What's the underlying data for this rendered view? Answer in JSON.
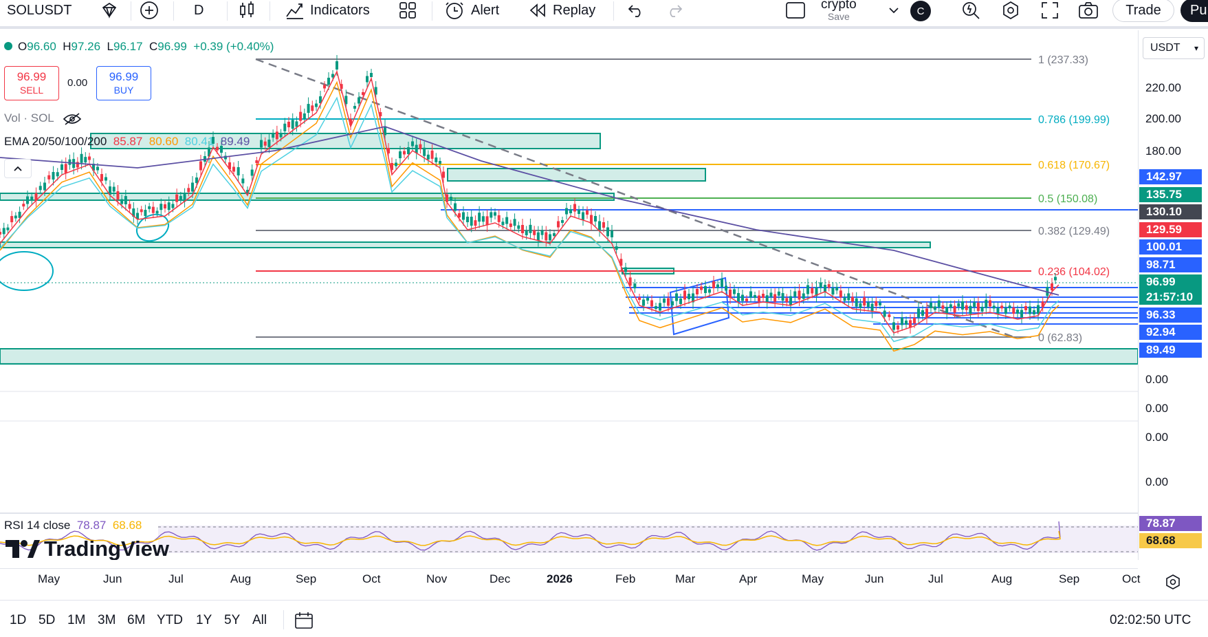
{
  "toolbar": {
    "symbol": "SOLUSDT",
    "interval": "D",
    "indicators_label": "Indicators",
    "alert_label": "Alert",
    "replay_label": "Replay",
    "layout_name": "crypto",
    "layout_save": "Save",
    "avatar_letter": "C",
    "trade_label": "Trade",
    "publish_label": "Pu"
  },
  "legend": {
    "open_label": "O",
    "open": "96.60",
    "high_label": "H",
    "high": "97.26",
    "low_label": "L",
    "low": "96.17",
    "close_label": "C",
    "close": "96.99",
    "change": "+0.39 (+0.40%)"
  },
  "quote": {
    "sell_price": "96.99",
    "sell_label": "SELL",
    "spread": "0.00",
    "buy_price": "96.99",
    "buy_label": "BUY"
  },
  "volume": {
    "label": "Vol · SOL"
  },
  "ema": {
    "label": "EMA 20/50/100/200",
    "values": [
      "85.87",
      "80.60",
      "80.41",
      "89.49"
    ],
    "colors": [
      "#f23645",
      "#ff9800",
      "#4dd0e1",
      "#5b4fa3"
    ]
  },
  "rsi": {
    "label": "RSI 14 close",
    "value": "78.87",
    "ma": "68.68"
  },
  "watermark": "TradingView",
  "price_axis": {
    "currency": "USDT",
    "ticks": [
      "220.00",
      "200.00",
      "180.00"
    ],
    "lower_ticks": [
      "0.00",
      "0.00",
      "0.00",
      "0.00"
    ]
  },
  "price_labels": [
    {
      "text": "142.97",
      "color": "#2962ff"
    },
    {
      "text": "135.75",
      "color": "#089981"
    },
    {
      "text": "130.10",
      "color": "#434651"
    },
    {
      "text": "129.59",
      "color": "#f23645"
    },
    {
      "text": "100.01",
      "color": "#2962ff"
    },
    {
      "text": "98.71",
      "color": "#2962ff"
    },
    {
      "text": "96.99",
      "color": "#089981"
    },
    {
      "text": "21:57:10",
      "color": "#089981"
    },
    {
      "text": "96.33",
      "color": "#2962ff"
    },
    {
      "text": "92.94",
      "color": "#2962ff"
    },
    {
      "text": "89.49",
      "color": "#2962ff"
    }
  ],
  "rsi_labels": [
    {
      "text": "78.87",
      "color": "#7e57c2"
    },
    {
      "text": "68.68",
      "color": "#f7c948"
    }
  ],
  "fib_levels": [
    {
      "label": "1 (237.33)",
      "color": "#787b86"
    },
    {
      "label": "0.786 (199.99)",
      "color": "#00acc1"
    },
    {
      "label": "0.618 (170.67)",
      "color": "#f7b500"
    },
    {
      "label": "0.5 (150.08)",
      "color": "#4caf50"
    },
    {
      "label": "0.382 (129.49)",
      "color": "#787b86"
    },
    {
      "label": "0.236 (104.02)",
      "color": "#f23645"
    },
    {
      "label": "0 (62.83)",
      "color": "#787b86"
    }
  ],
  "months": [
    "May",
    "Jun",
    "Jul",
    "Aug",
    "Sep",
    "Oct",
    "Nov",
    "Dec",
    "2026",
    "Feb",
    "Mar",
    "Apr",
    "May",
    "Jun",
    "Jul",
    "Aug",
    "Sep",
    "Oct"
  ],
  "ranges": [
    "1D",
    "5D",
    "1M",
    "3M",
    "6M",
    "YTD",
    "1Y",
    "5Y",
    "All"
  ],
  "clock": "02:02:50 UTC"
}
